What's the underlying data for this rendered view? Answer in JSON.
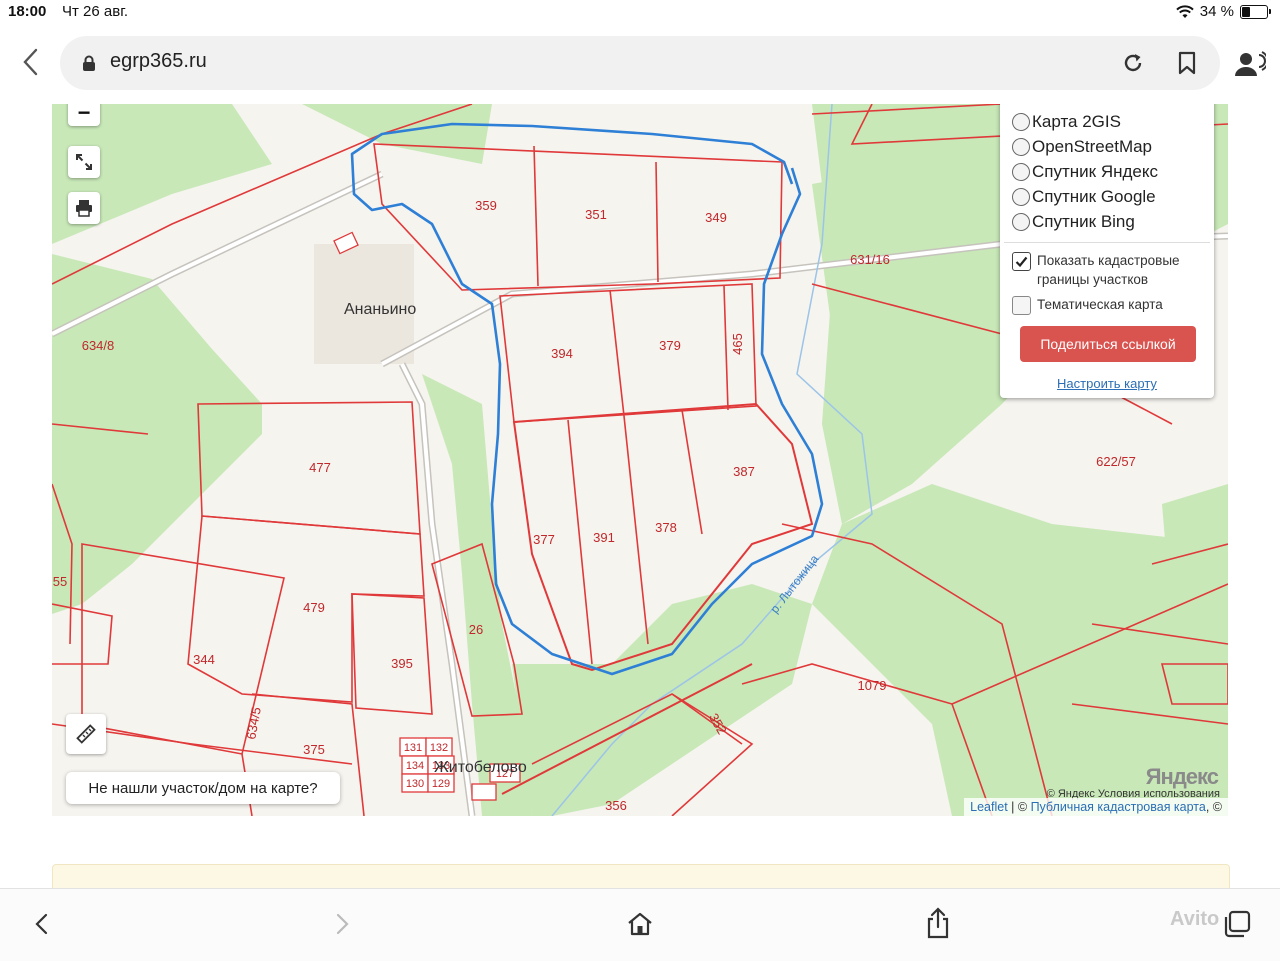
{
  "status_bar": {
    "time": "18:00",
    "date": "Чт 26 авг.",
    "battery": "34 %",
    "battery_level": 0.34
  },
  "browser": {
    "url": "egrp365.ru",
    "icons": [
      "back-icon",
      "lock-icon",
      "reload-icon",
      "bookmark-icon",
      "profile-icon"
    ]
  },
  "map": {
    "settlements": [
      "Ананьино",
      "Житобелово"
    ],
    "river_label": "р. Лытожица",
    "parcels": [
      "359",
      "351",
      "349",
      "394",
      "379",
      "465",
      "631/16",
      "634/8",
      "477",
      "387",
      "622/57",
      "377",
      "391",
      "378",
      "55",
      "479",
      "344",
      "26",
      "395",
      "1079",
      "352",
      "375",
      "634/5",
      "131",
      "132",
      "134",
      "133",
      "130",
      "129",
      "127",
      "356"
    ],
    "controls": {
      "zoom_out": "−",
      "icons": [
        "fullscreen-icon",
        "print-icon",
        "ruler-icon"
      ]
    },
    "layers": {
      "options": [
        "Карта 2GIS",
        "OpenStreetMap",
        "Спутник Яндекс",
        "Спутник Google",
        "Спутник Bing"
      ],
      "show_cadastral": "Показать кадастровые границы участков",
      "show_cadastral_checked": true,
      "thematic": "Тематическая карта",
      "thematic_checked": false,
      "share_button": "Поделиться ссылкой",
      "configure_link": "Настроить карту"
    },
    "not_found_button": "Не нашли участок/дом на карте?",
    "attribution": {
      "leaflet": "Leaflet",
      "sep": " | © ",
      "cadastral": "Публичная кадастровая карта",
      "tail": ", ©"
    },
    "yandex_credit": "© Яндекс  Условия использования",
    "yandex_logo": "Яндекс",
    "colors": {
      "forest": "#c8e8b8",
      "field": "#f6f4ef",
      "boundary": "#e0393a",
      "route": "#2e7fd6",
      "river": "#9cc4e8"
    }
  },
  "watermark": "Avito"
}
